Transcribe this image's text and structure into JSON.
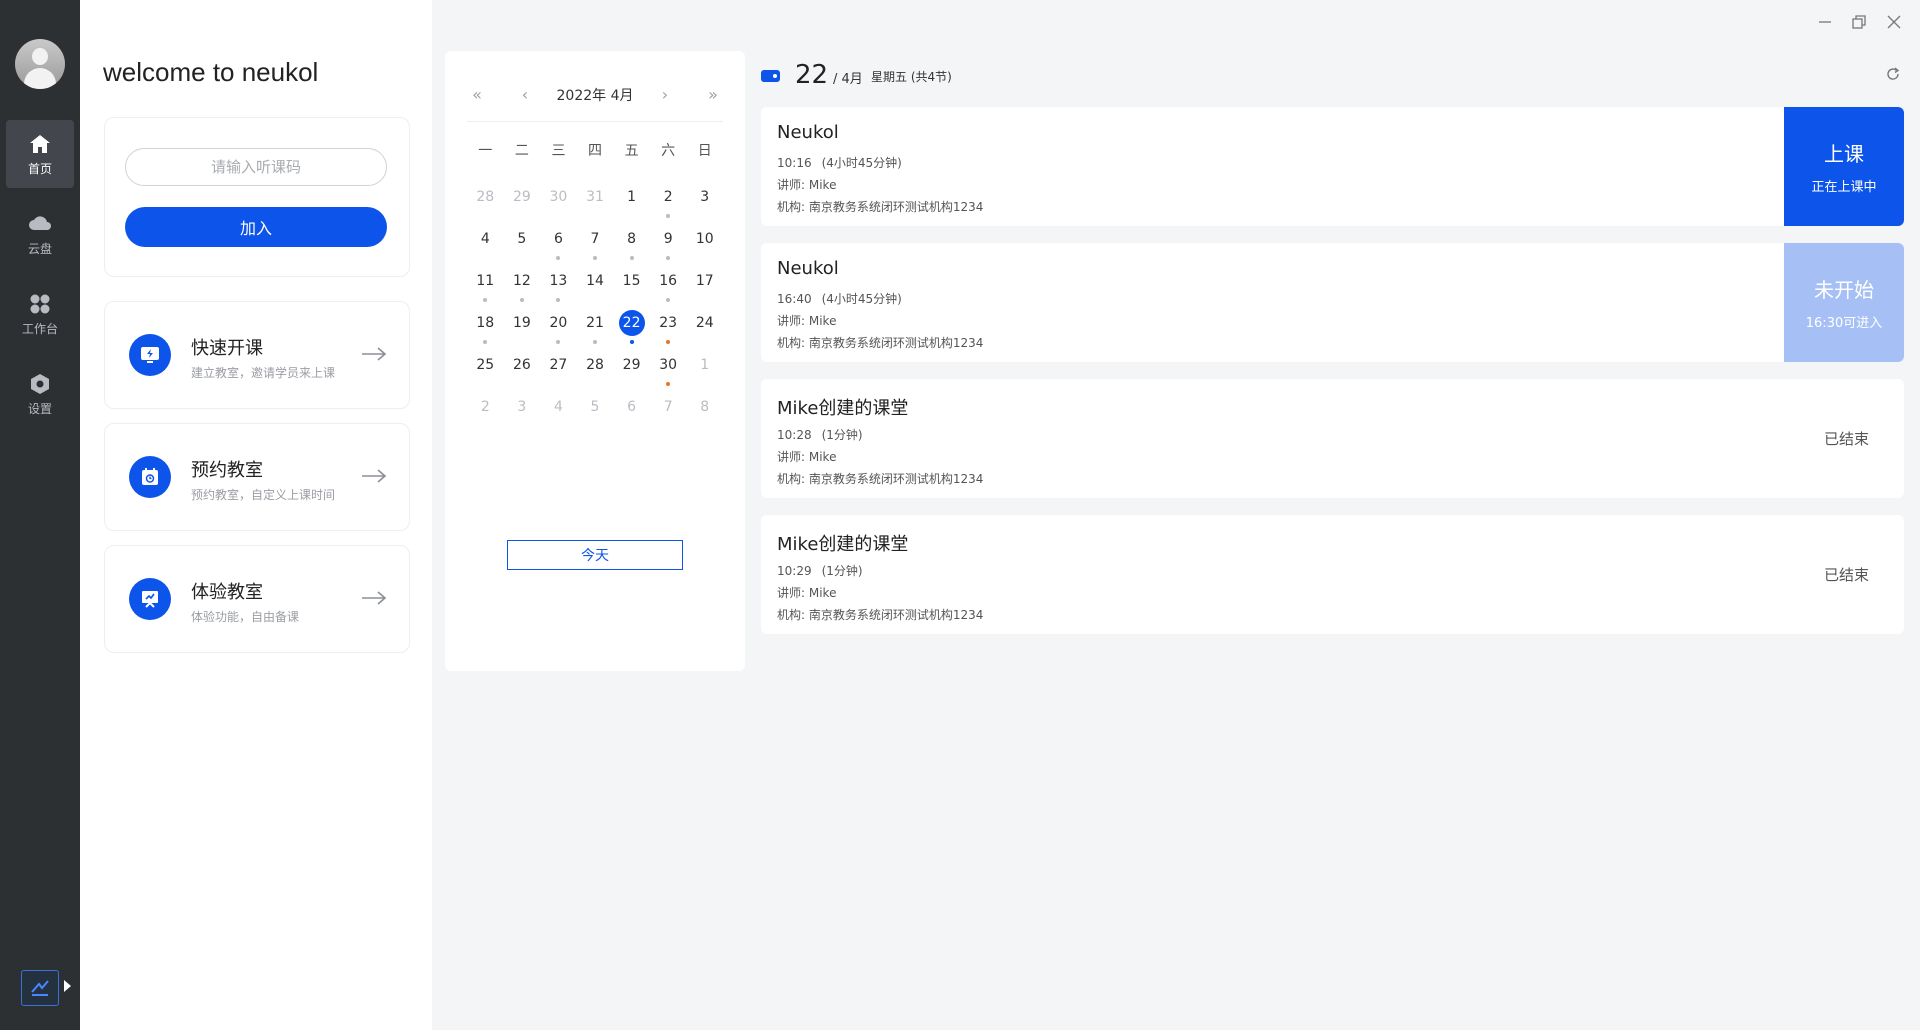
{
  "sidebar": {
    "items": [
      {
        "label": "首页",
        "icon": "home-icon",
        "active": true
      },
      {
        "label": "云盘",
        "icon": "cloud-icon",
        "active": false
      },
      {
        "label": "工作台",
        "icon": "workbench-icon",
        "active": false
      },
      {
        "label": "设置",
        "icon": "settings-icon",
        "active": false
      }
    ]
  },
  "left": {
    "welcome": "welcome to neukol",
    "join": {
      "placeholder": "请输入听课码",
      "button": "加入"
    },
    "features": [
      {
        "title": "快速开课",
        "subtitle": "建立教室，邀请学员来上课",
        "icon": "quick-class-icon"
      },
      {
        "title": "预约教室",
        "subtitle": "预约教室，自定义上课时间",
        "icon": "calendar-booking-icon"
      },
      {
        "title": "体验教室",
        "subtitle": "体验功能，自由备课",
        "icon": "trial-classroom-icon"
      }
    ]
  },
  "calendar": {
    "title": "2022年 4月",
    "weekdays": [
      "一",
      "二",
      "三",
      "四",
      "五",
      "六",
      "日"
    ],
    "today_button": "今天",
    "weeks": [
      [
        {
          "d": "28",
          "o": 1
        },
        {
          "d": "29",
          "o": 1
        },
        {
          "d": "30",
          "o": 1
        },
        {
          "d": "31",
          "o": 1
        },
        {
          "d": "1"
        },
        {
          "d": "2",
          "dot": "gray"
        },
        {
          "d": "3"
        }
      ],
      [
        {
          "d": "4"
        },
        {
          "d": "5"
        },
        {
          "d": "6",
          "dot": "gray"
        },
        {
          "d": "7",
          "dot": "gray"
        },
        {
          "d": "8",
          "dot": "gray"
        },
        {
          "d": "9",
          "dot": "gray"
        },
        {
          "d": "10"
        }
      ],
      [
        {
          "d": "11",
          "dot": "gray"
        },
        {
          "d": "12",
          "dot": "gray"
        },
        {
          "d": "13",
          "dot": "gray"
        },
        {
          "d": "14"
        },
        {
          "d": "15"
        },
        {
          "d": "16",
          "dot": "gray"
        },
        {
          "d": "17"
        }
      ],
      [
        {
          "d": "18",
          "dot": "gray"
        },
        {
          "d": "19"
        },
        {
          "d": "20",
          "dot": "gray"
        },
        {
          "d": "21",
          "dot": "gray"
        },
        {
          "d": "22",
          "today": 1,
          "dot": "blue"
        },
        {
          "d": "23",
          "dot": "orange"
        },
        {
          "d": "24"
        }
      ],
      [
        {
          "d": "25"
        },
        {
          "d": "26"
        },
        {
          "d": "27"
        },
        {
          "d": "28"
        },
        {
          "d": "29"
        },
        {
          "d": "30",
          "dot": "orange"
        },
        {
          "d": "1",
          "o": 1
        }
      ],
      [
        {
          "d": "2",
          "o": 1
        },
        {
          "d": "3",
          "o": 1
        },
        {
          "d": "4",
          "o": 1
        },
        {
          "d": "5",
          "o": 1
        },
        {
          "d": "6",
          "o": 1
        },
        {
          "d": "7",
          "o": 1
        },
        {
          "d": "8",
          "o": 1
        }
      ]
    ]
  },
  "schedule": {
    "day": "22",
    "month": "/ 4月",
    "weekday_info": "星期五 (共4节)",
    "courses": [
      {
        "name": "Neukol",
        "time": "10:16",
        "duration": "(4小时45分钟)",
        "teacher": "讲师: Mike",
        "org": "机构: 南京教务系统闭环测试机构1234",
        "status": "live",
        "status_main": "上课",
        "status_sub": "正在上课中"
      },
      {
        "name": "Neukol",
        "time": "16:40",
        "duration": "(4小时45分钟)",
        "teacher": "讲师: Mike",
        "org": "机构: 南京教务系统闭环测试机构1234",
        "status": "pending",
        "status_main": "未开始",
        "status_sub": "16:30可进入"
      },
      {
        "name": "Mike创建的课堂",
        "time": "10:28",
        "duration": "(1分钟)",
        "teacher": "讲师: Mike",
        "org": "机构: 南京教务系统闭环测试机构1234",
        "status": "ended",
        "status_main": "已结束",
        "status_sub": ""
      },
      {
        "name": "Mike创建的课堂",
        "time": "10:29",
        "duration": "(1分钟)",
        "teacher": "讲师: Mike",
        "org": "机构: 南京教务系统闭环测试机构1234",
        "status": "ended",
        "status_main": "已结束",
        "status_sub": ""
      }
    ]
  },
  "colors": {
    "accent": "#0d54ea",
    "pending": "#a6c0f5",
    "sidebar": "#2d3033",
    "dot_orange": "#e7742a"
  }
}
